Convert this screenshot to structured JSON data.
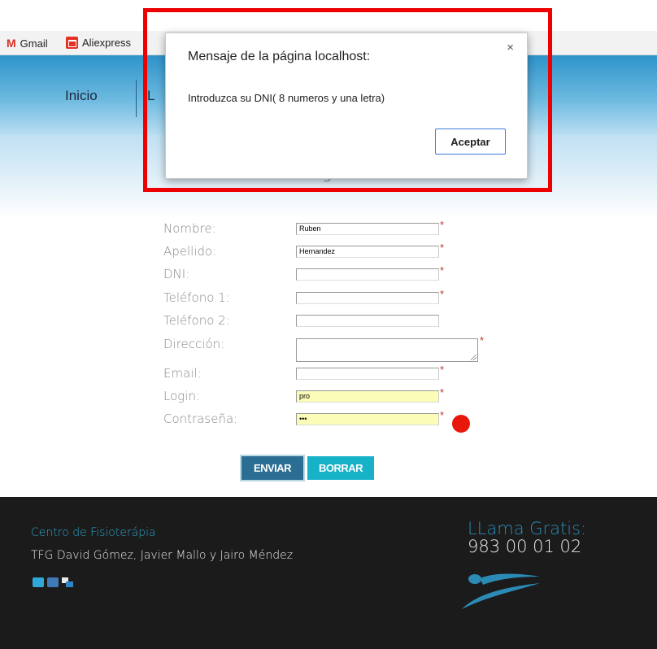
{
  "bookmarks": [
    {
      "label": "Gmail",
      "icon": "gmail-icon"
    },
    {
      "label": "Aliexpress",
      "icon": "aliexpress-icon"
    }
  ],
  "nav": {
    "inicio": "Inicio",
    "second_initial": "L"
  },
  "hero": {
    "title_fragment": "g"
  },
  "form": {
    "fields": [
      {
        "label": "Nombre:",
        "value": "Ruben",
        "required": true
      },
      {
        "label": "Apellido:",
        "value": "Hernandez",
        "required": true
      },
      {
        "label": "DNI:",
        "value": "",
        "required": true
      },
      {
        "label": "Teléfono 1:",
        "value": "",
        "required": true
      },
      {
        "label": "Teléfono 2:",
        "value": "",
        "required": false
      },
      {
        "label": "Dirección:",
        "value": "",
        "required": true
      },
      {
        "label": "Email:",
        "value": "",
        "required": true
      },
      {
        "label": "Login:",
        "value": "pro",
        "required": true
      },
      {
        "label": "Contraseña:",
        "value": "•••",
        "required": true
      }
    ],
    "required_mark": "*",
    "send_label": "ENVIAR",
    "clear_label": "BORRAR"
  },
  "footer": {
    "title": "Centro de Fisioterápia",
    "credits": "TFG David Gómez, Javier Mallo y Jairo Méndez",
    "call_label": "LLama Gratis:",
    "phone": "983 00 01 02",
    "socials": [
      "twitter-icon",
      "linkedin-icon",
      "flickr-icon"
    ]
  },
  "dialog": {
    "title": "Mensaje de la página localhost:",
    "message": "Introduzca su DNI( 8 numeros y una letra)",
    "ok_label": "Aceptar",
    "close_symbol": "×"
  },
  "colors": {
    "highlight_frame": "#ee0000",
    "accent_teal": "#18b2c8",
    "accent_blue": "#2b6e93",
    "footer_bg": "#1b1b1b",
    "status_dot": "#e8180b"
  }
}
